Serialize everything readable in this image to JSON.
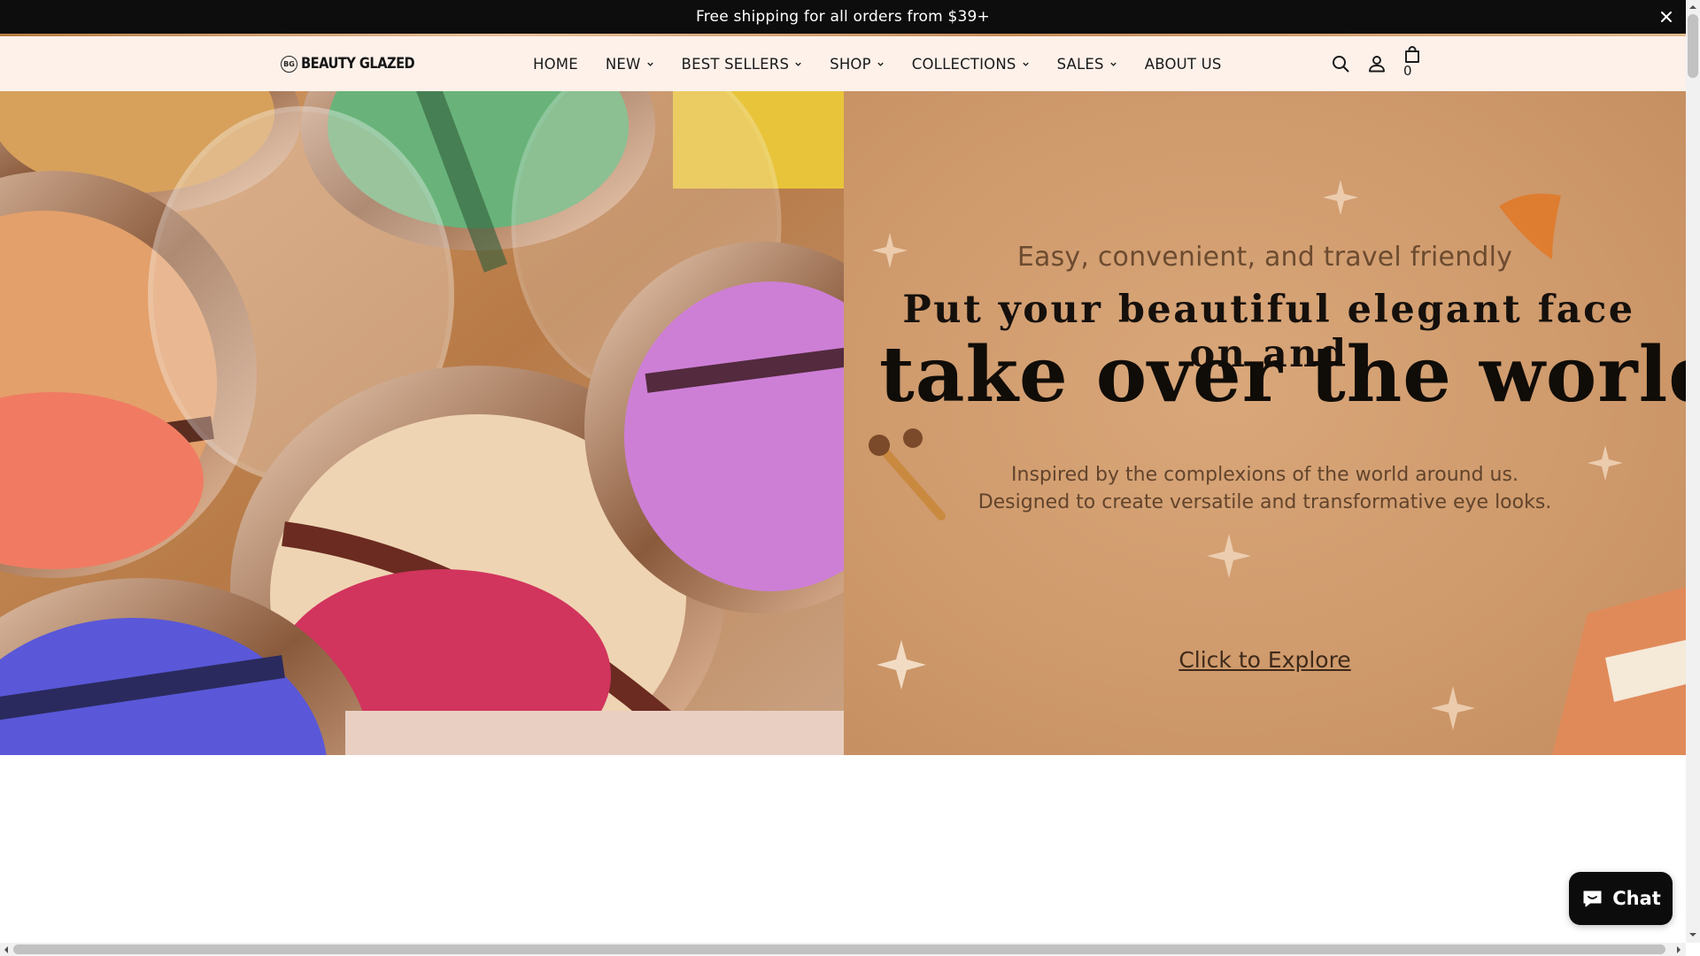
{
  "announcement": {
    "text": "Free shipping for all orders from $39+",
    "close_icon": "close-icon"
  },
  "header": {
    "logo_text": "BEAUTY GLAZED",
    "logo_mark": "BG",
    "nav": [
      {
        "label": "HOME",
        "has_dropdown": false
      },
      {
        "label": "NEW",
        "has_dropdown": true
      },
      {
        "label": "BEST SELLERS",
        "has_dropdown": true
      },
      {
        "label": "SHOP",
        "has_dropdown": true
      },
      {
        "label": "COLLECTIONS",
        "has_dropdown": true
      },
      {
        "label": "SALES",
        "has_dropdown": true
      },
      {
        "label": "ABOUT US",
        "has_dropdown": false
      }
    ],
    "icons": [
      "search-icon",
      "account-icon",
      "cart-icon"
    ],
    "cart_count": "0"
  },
  "hero": {
    "subtitle": "Easy, convenient, and travel friendly",
    "headline_line1": "Put your beautiful elegant face on and",
    "headline_line2": "take over the world.",
    "body_line1": "Inspired by the complexions of the world around us.",
    "body_line2": "Designed to create versatile and transformative eye looks.",
    "cta": "Click to Explore"
  },
  "chat": {
    "label": "Chat",
    "icon": "chat-bubble-icon"
  },
  "colors": {
    "announcement_bg": "#0d0d0d",
    "header_bg": "#fdf1ea",
    "hero_panel_bg": "#cf9a6c",
    "chat_bg": "#0c0c0c"
  }
}
